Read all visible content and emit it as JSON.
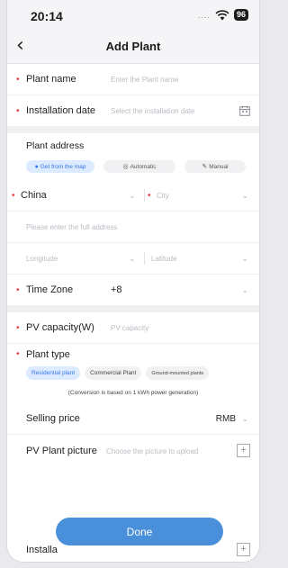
{
  "status_bar": {
    "time": "20:14",
    "signal_dots": "....",
    "battery": "96"
  },
  "nav": {
    "back_glyph": "‹",
    "title": "Add Plant"
  },
  "form": {
    "plant_name": {
      "label": "Plant name",
      "placeholder": "Enter the Plant name"
    },
    "installation_date": {
      "label": "Installation date",
      "placeholder": "Select the installation date"
    },
    "plant_address": {
      "title": "Plant address",
      "modes": [
        "Get from the map",
        "Automatic",
        "Manual"
      ],
      "country": "China",
      "city_placeholder": "City",
      "address_placeholder": "Please enter the full address",
      "longitude_placeholder": "Longitude",
      "latitude_placeholder": "Latitude"
    },
    "time_zone": {
      "label": "Time Zone",
      "value": "+8"
    },
    "pv_capacity": {
      "label": "PV capacity(W)",
      "placeholder": "PV capacity"
    },
    "plant_type": {
      "label": "Plant type",
      "options": [
        "Residential plant",
        "Commercial Plant",
        "Ground-mounted plants"
      ],
      "note": "(Conversion is based on 1 kWh power generation)"
    },
    "selling_price": {
      "label": "Selling price",
      "currency": "RMB"
    },
    "pv_plant_picture": {
      "label": "PV Plant picture",
      "placeholder": "Choose the picture to upload"
    },
    "installation_partial": {
      "label": "Installa"
    }
  },
  "done_button": {
    "label": "Done"
  },
  "colors": {
    "accent": "#3777ea",
    "required": "#e23b3b",
    "done": "#4a8fd9"
  }
}
